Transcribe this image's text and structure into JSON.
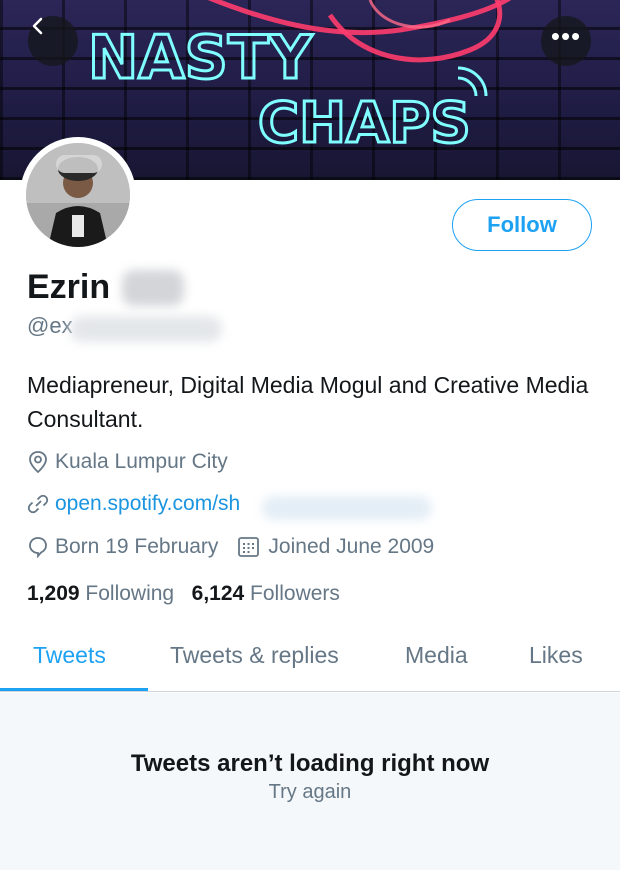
{
  "banner": {
    "neon_line1": "NASTY",
    "neon_line2": "CHAPS"
  },
  "profile": {
    "name": "Ezrin",
    "handle": "@ex",
    "follow_label": "Follow",
    "bio": "Mediapreneur, Digital Media Mogul and Creative Media Consultant.",
    "location": "Kuala Lumpur City",
    "website": "open.spotify.com/sh",
    "birthday": "Born 19 February",
    "joined": "Joined June 2009",
    "following_count": "1,209",
    "following_label": "Following",
    "followers_count": "6,124",
    "followers_label": "Followers"
  },
  "tabs": [
    {
      "label": "Tweets",
      "active": true
    },
    {
      "label": "Tweets & replies",
      "active": false
    },
    {
      "label": "Media",
      "active": false
    },
    {
      "label": "Likes",
      "active": false
    }
  ],
  "feed": {
    "error_title": "Tweets aren’t loading right now",
    "retry_label": "Try again"
  },
  "colors": {
    "accent": "#1da1f2",
    "link": "#1b95e0",
    "secondary_text": "#657786",
    "primary_text": "#14171a"
  },
  "icons": [
    "back-arrow-icon",
    "more-icon",
    "location-icon",
    "link-icon",
    "birthday-icon",
    "calendar-icon"
  ]
}
